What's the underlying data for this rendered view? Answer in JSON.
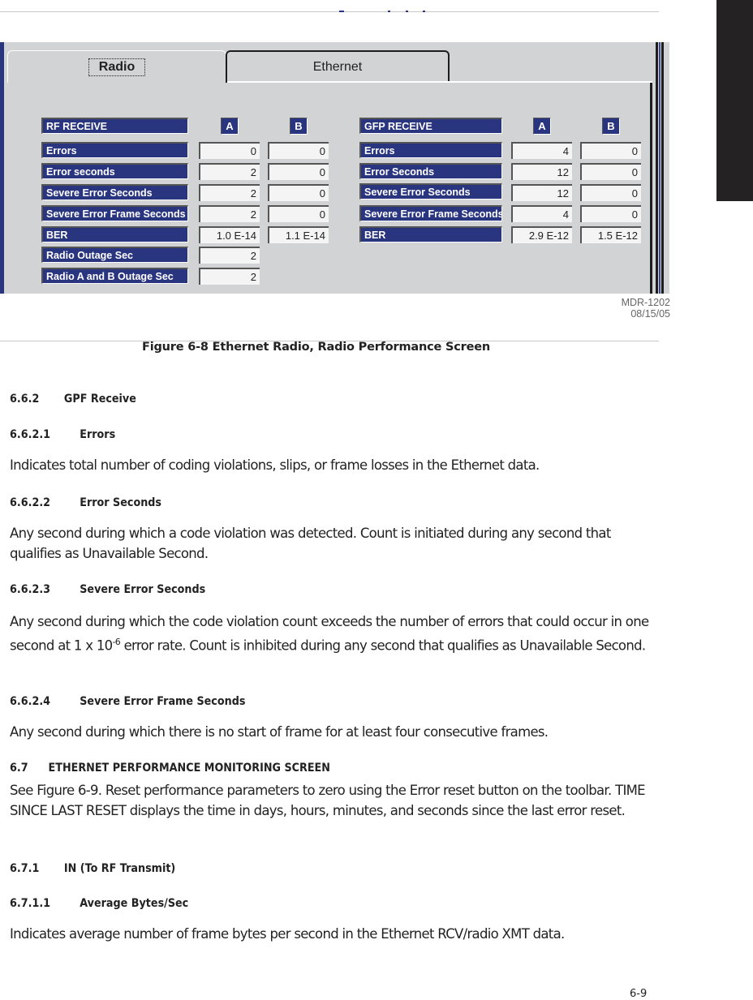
{
  "figure": {
    "tabs": [
      {
        "label": "Radio",
        "active": true
      },
      {
        "label": "Ethernet",
        "active": false
      }
    ],
    "rf_receive": {
      "title": "RF RECEIVE",
      "col_a": "A",
      "col_b": "B",
      "rows": [
        {
          "label": "Errors",
          "a": "0",
          "b": "0"
        },
        {
          "label": "Error seconds",
          "a": "2",
          "b": "0"
        },
        {
          "label": "Severe Error Seconds",
          "a": "2",
          "b": "0"
        },
        {
          "label": "Severe Error Frame Seconds",
          "a": "2",
          "b": "0"
        },
        {
          "label": "BER",
          "a": "1.0 E-14",
          "b": "1.1 E-14"
        },
        {
          "label": "Radio Outage Sec",
          "a": "2"
        },
        {
          "label": "Radio A and B Outage Sec",
          "a": "2"
        }
      ]
    },
    "gfp_receive": {
      "title": "GFP RECEIVE",
      "col_a": "A",
      "col_b": "B",
      "rows": [
        {
          "label": "Errors",
          "a": "4",
          "b": "0"
        },
        {
          "label": "Error Seconds",
          "a": "12",
          "b": "0"
        },
        {
          "label": "Severe Error Seconds",
          "a": "12",
          "b": "0"
        },
        {
          "label": "Severe Error Frame Seconds",
          "a": "4",
          "b": "0"
        },
        {
          "label": "BER",
          "a": "2.9 E-12",
          "b": "1.5 E-12"
        }
      ]
    },
    "figure_id": "MDR-1202",
    "figure_date": "08/15/05",
    "caption": "Figure 6-8   Ethernet Radio, Radio Performance Screen"
  },
  "sections": [
    {
      "num": "6.6.2",
      "title": "GPF Receive"
    },
    {
      "num": "6.6.2.1",
      "title": "Errors",
      "body": "Indicates total number of coding violations, slips, or frame losses in the Ethernet data."
    },
    {
      "num": "6.6.2.2",
      "title": "Error Seconds",
      "body": "Any second during which a code violation was detected. Count is initiated during any second that qualifies as Unavailable Second."
    },
    {
      "num": "6.6.2.3",
      "title": "Severe Error Seconds",
      "body_pre": "Any second during which the code violation count exceeds the number of errors that could occur in one second at 1 x 10",
      "body_sup": "-6",
      "body_post": " error rate. Count is inhibited during any second that qualifies as Unavailable Second."
    },
    {
      "num": "6.6.2.4",
      "title": "Severe Error Frame Seconds",
      "body": "Any second during which there is no start of frame for at least four consecutive frames."
    },
    {
      "num": "6.7",
      "title": "ETHERNET PERFORMANCE MONITORING SCREEN",
      "body": "See Figure 6-9. Reset performance parameters to zero using the Error reset button on the toolbar. TIME SINCE LAST RESET displays the time in days, hours, minutes, and seconds since the last error reset."
    },
    {
      "num": "6.7.1",
      "title": "IN (To RF Transmit)"
    },
    {
      "num": "6.7.1.1",
      "title": "Average Bytes/Sec",
      "body": "Indicates average number of frame bytes per second in the Ethernet RCV/radio XMT data."
    }
  ],
  "page_number": "6-9",
  "colors": {
    "label_blue": "#2a3580",
    "panel_gray": "#d2d3d5",
    "thumb_tab": "#242223"
  }
}
